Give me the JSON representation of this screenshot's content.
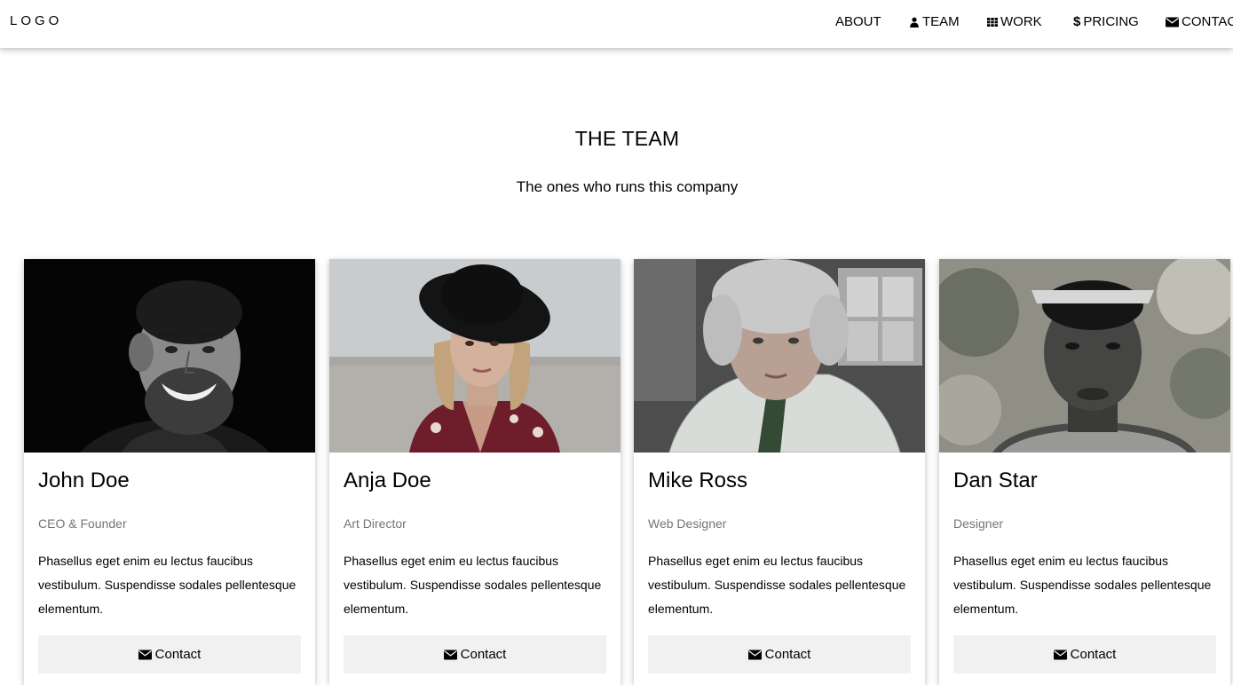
{
  "nav": {
    "logo": "LOGO",
    "items": [
      {
        "label": "ABOUT",
        "icon": ""
      },
      {
        "label": "TEAM",
        "icon": "user-icon"
      },
      {
        "label": "WORK",
        "icon": "grid-icon"
      },
      {
        "label": "PRICING",
        "icon": "dollar-icon"
      },
      {
        "label": "CONTACT",
        "icon": "envelope-icon"
      }
    ]
  },
  "team": {
    "title": "THE TEAM",
    "subtitle": "The ones who runs this company",
    "members": [
      {
        "name": "John Doe",
        "role": "CEO & Founder",
        "description": "Phasellus eget enim eu lectus faucibus vestibulum. Suspendisse sodales pellentesque elementum.",
        "button": "Contact",
        "photo": "smiling-bearded-man-portrait"
      },
      {
        "name": "Anja Doe",
        "role": "Art Director",
        "description": "Phasellus eget enim eu lectus faucibus vestibulum. Suspendisse sodales pellentesque elementum.",
        "button": "Contact",
        "photo": "woman-in-black-hat-portrait"
      },
      {
        "name": "Mike Ross",
        "role": "Web Designer",
        "description": "Phasellus eget enim eu lectus faucibus vestibulum. Suspendisse sodales pellentesque elementum.",
        "button": "Contact",
        "photo": "grey-haired-man-in-checkered-shirt-portrait"
      },
      {
        "name": "Dan Star",
        "role": "Designer",
        "description": "Phasellus eget enim eu lectus faucibus vestibulum. Suspendisse sodales pellentesque elementum.",
        "button": "Contact",
        "photo": "young-man-with-sunglasses-on-head-portrait"
      }
    ]
  },
  "colors": {
    "button_bg": "#f1f1f1",
    "muted_text": "#757575"
  }
}
